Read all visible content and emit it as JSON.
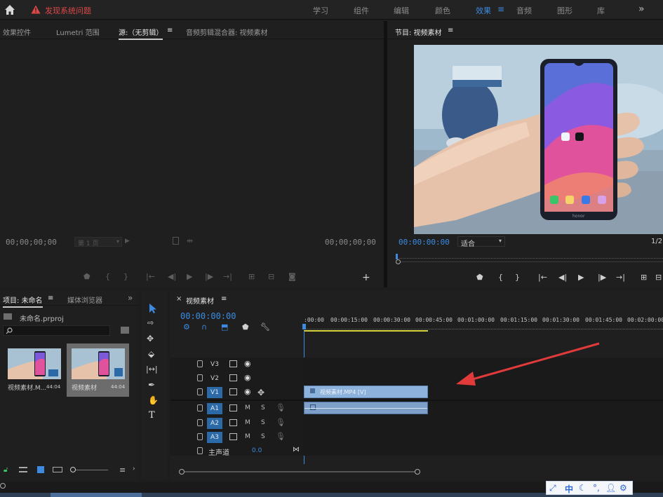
{
  "topbar": {
    "warning_text": "发现系统问题",
    "workspaces": [
      "学习",
      "组件",
      "编辑",
      "颜色",
      "效果",
      "音频",
      "图形",
      "库"
    ],
    "active_workspace": "效果",
    "more": "»"
  },
  "source_panel": {
    "tabs": [
      "效果控件",
      "Lumetri 范围",
      "源:（无剪辑）",
      "音频剪辑混合器: 视频素材"
    ],
    "menu_icon": "≡",
    "timecode_in": "00;00;00;00",
    "timecode_out": "00;00;00;00",
    "page_select": "第 1 页",
    "add": "+"
  },
  "program_panel": {
    "title": "节目: 视频素材",
    "menu_icon": "≡",
    "timecode": "00:00:00:00",
    "fit": "适合",
    "ratio": "1/2",
    "phone_brand": "honor"
  },
  "project_panel": {
    "tabs": [
      "项目: 未命名",
      "媒体浏览器"
    ],
    "menu_icon": "≡",
    "more": "»",
    "project_file": "未命名.prproj",
    "search_placeholder": "",
    "items": [
      {
        "name": "视频素材.M...",
        "duration": "44:04"
      },
      {
        "name": "视频素材",
        "duration": "44:04"
      }
    ]
  },
  "timeline": {
    "tab": "视频素材",
    "menu_icon": "≡",
    "close": "×",
    "timecode": "00:00:00:00",
    "ruler": [
      ":00:00",
      "00:00:15:00",
      "00:00:30:00",
      "00:00:45:00",
      "00:01:00:00",
      "00:01:15:00",
      "00:01:30:00",
      "00:01:45:00",
      "00:02:00:00"
    ],
    "video_tracks": [
      "V3",
      "V2",
      "V1"
    ],
    "audio_tracks": [
      "A1",
      "A2",
      "A3"
    ],
    "mute": "M",
    "solo": "S",
    "master_label": "主声道",
    "master_value": "0.0",
    "video_clip_label": "视频素材.MP4 [V]"
  },
  "ime_bar": {
    "items": [
      "中"
    ]
  },
  "colors": {
    "accent": "#3c8be0",
    "warning": "#e04848",
    "arrow": "#e03a3a"
  }
}
